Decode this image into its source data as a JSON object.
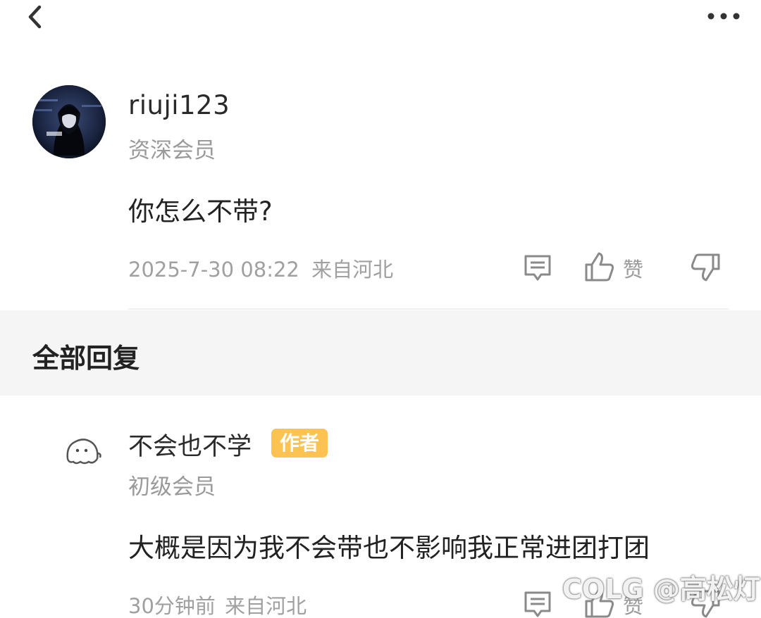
{
  "header": {
    "back_icon": "chevron-left-icon",
    "more_icon": "more-horizontal-icon"
  },
  "post": {
    "username": "riuji123",
    "level": "资深会员",
    "content": "你怎么不带?",
    "timestamp": "2025-7-30 08:22",
    "location": "来自河北",
    "like_label": "赞"
  },
  "replies_section": {
    "title": "全部回复"
  },
  "reply": {
    "username": "不会也不学",
    "badge": "作者",
    "level": "初级会员",
    "content": "大概是因为我不会带也不影响我正常进团打团",
    "timestamp": "30分钟前",
    "location": "来自河北",
    "like_label": "赞"
  },
  "watermark": "COLG @高松灯",
  "colors": {
    "badge": "#fcc353",
    "muted_text": "#9a9a9a",
    "section_bg": "#f5f5f5"
  }
}
